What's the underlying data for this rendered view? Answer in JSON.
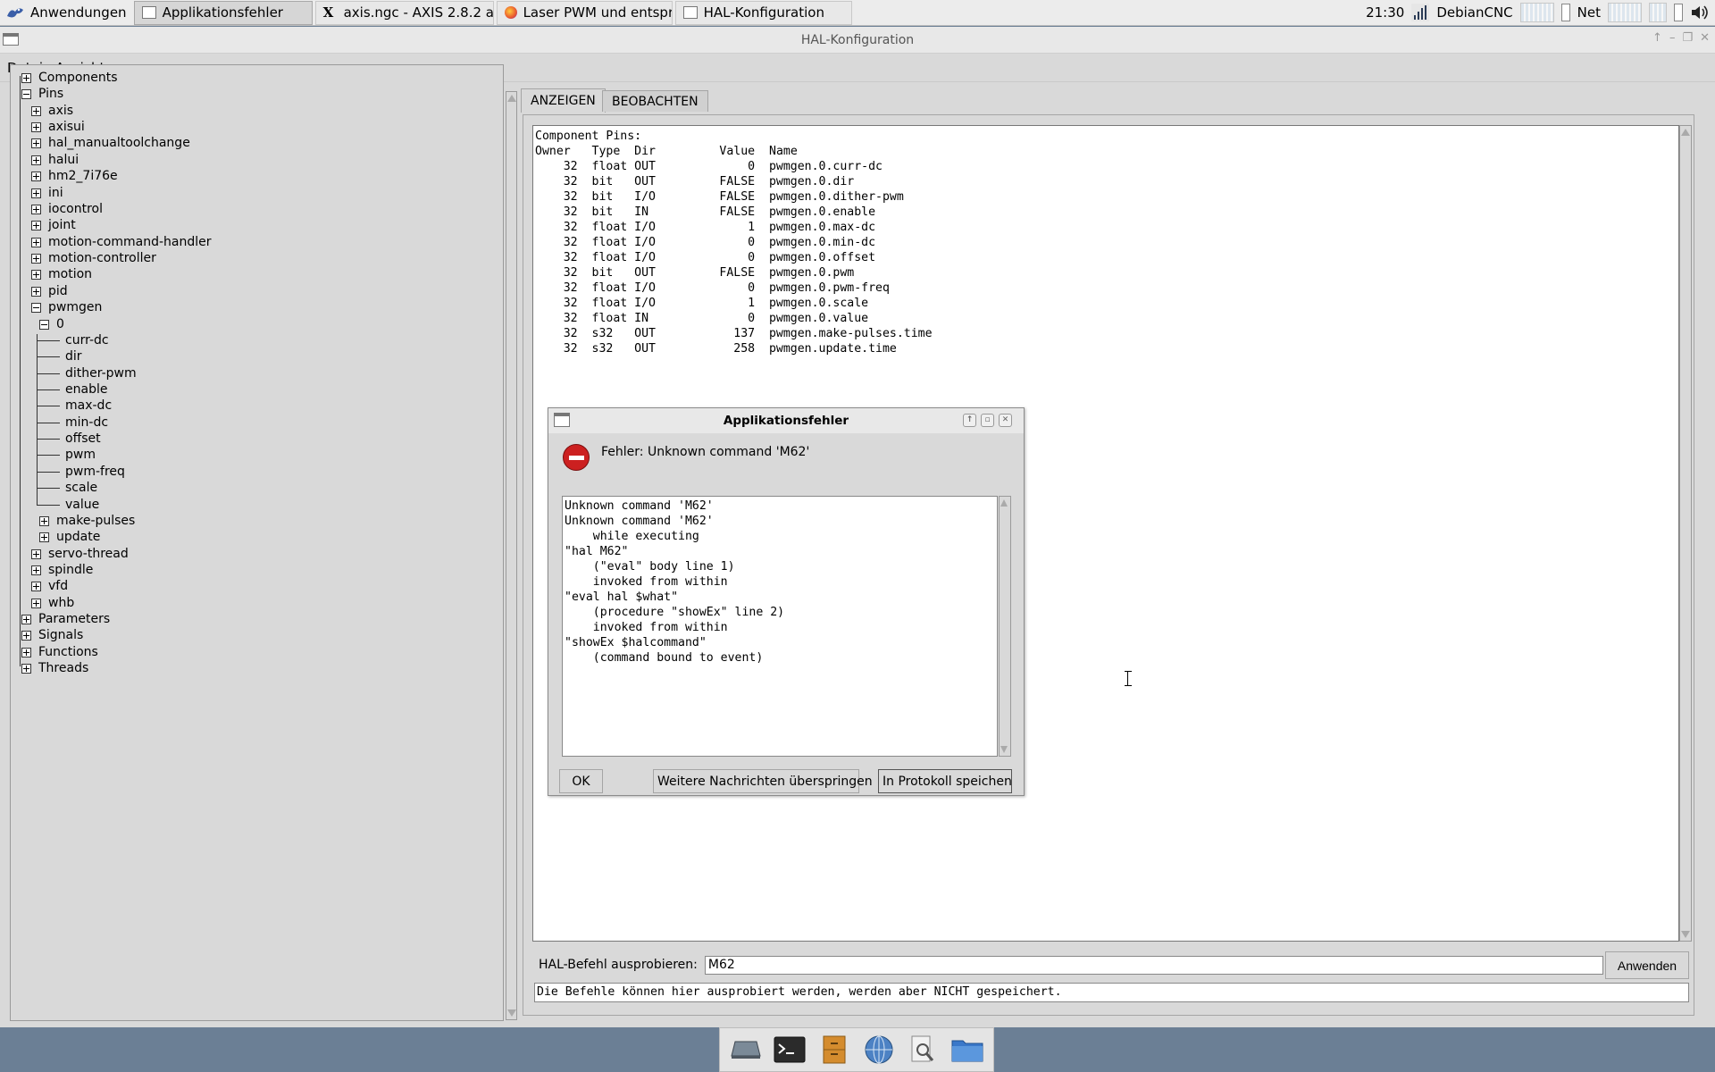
{
  "taskbar": {
    "app_menu": "Anwendungen",
    "tasks": [
      "Applikationsfehler",
      "axis.ngc - AXIS 2.8.2 au...",
      "Laser PWM und entspre...",
      "HAL-Konfiguration"
    ],
    "clock": "21:30",
    "host": "DebianCNC",
    "net_label": "Net"
  },
  "window": {
    "title": "HAL-Konfiguration",
    "menu": [
      "Datei",
      "Ansicht"
    ]
  },
  "tree": {
    "components": "Components",
    "pins": "Pins",
    "pin_groups_top": [
      "axis",
      "axisui",
      "hal_manualtoolchange",
      "halui",
      "hm2_7i76e",
      "ini",
      "iocontrol",
      "joint",
      "motion-command-handler",
      "motion-controller",
      "motion",
      "pid"
    ],
    "pwmgen": "pwmgen",
    "pwmgen_0": "0",
    "pwmgen_0_pins": [
      "curr-dc",
      "dir",
      "dither-pwm",
      "enable",
      "max-dc",
      "min-dc",
      "offset",
      "pwm",
      "pwm-freq",
      "scale",
      "value"
    ],
    "pwmgen_sub": [
      "make-pulses",
      "update"
    ],
    "pin_groups_bottom": [
      "servo-thread",
      "spindle",
      "vfd",
      "whb"
    ],
    "root_bottom": [
      "Parameters",
      "Signals",
      "Functions",
      "Threads"
    ]
  },
  "tabs": [
    "ANZEIGEN",
    "BEOBACHTEN"
  ],
  "pins_view": {
    "heading": "Component Pins:",
    "header": "Owner   Type  Dir         Value  Name",
    "rows": [
      [
        "32",
        "float",
        "OUT",
        "0",
        "pwmgen.0.curr-dc"
      ],
      [
        "32",
        "bit",
        "OUT",
        "FALSE",
        "pwmgen.0.dir"
      ],
      [
        "32",
        "bit",
        "I/O",
        "FALSE",
        "pwmgen.0.dither-pwm"
      ],
      [
        "32",
        "bit",
        "IN",
        "FALSE",
        "pwmgen.0.enable"
      ],
      [
        "32",
        "float",
        "I/O",
        "1",
        "pwmgen.0.max-dc"
      ],
      [
        "32",
        "float",
        "I/O",
        "0",
        "pwmgen.0.min-dc"
      ],
      [
        "32",
        "float",
        "I/O",
        "0",
        "pwmgen.0.offset"
      ],
      [
        "32",
        "bit",
        "OUT",
        "FALSE",
        "pwmgen.0.pwm"
      ],
      [
        "32",
        "float",
        "I/O",
        "0",
        "pwmgen.0.pwm-freq"
      ],
      [
        "32",
        "float",
        "I/O",
        "1",
        "pwmgen.0.scale"
      ],
      [
        "32",
        "float",
        "IN",
        "0",
        "pwmgen.0.value"
      ],
      [
        "32",
        "s32",
        "OUT",
        "137",
        "pwmgen.make-pulses.time"
      ],
      [
        "32",
        "s32",
        "OUT",
        "258",
        "pwmgen.update.time"
      ]
    ]
  },
  "command": {
    "label": "HAL-Befehl ausprobieren:",
    "value": "M62",
    "apply": "Anwenden",
    "hint": "Die Befehle können hier ausprobiert werden, werden aber NICHT gespeichert."
  },
  "dialog": {
    "title": "Applikationsfehler",
    "message": "Fehler: Unknown command 'M62'",
    "details": [
      "Unknown command 'M62'",
      "Unknown command 'M62'",
      "    while executing",
      "\"hal M62\"",
      "    (\"eval\" body line 1)",
      "    invoked from within",
      "\"eval hal $what\"",
      "    (procedure \"showEx\" line 2)",
      "    invoked from within",
      "\"showEx $halcommand\"",
      "    (command bound to event)"
    ],
    "ok": "OK",
    "skip": "Weitere Nachrichten überspringen",
    "save": "In Protokoll speichen"
  },
  "colors": {
    "error_red": "#cc2020",
    "desktop": "#6b7f95"
  }
}
